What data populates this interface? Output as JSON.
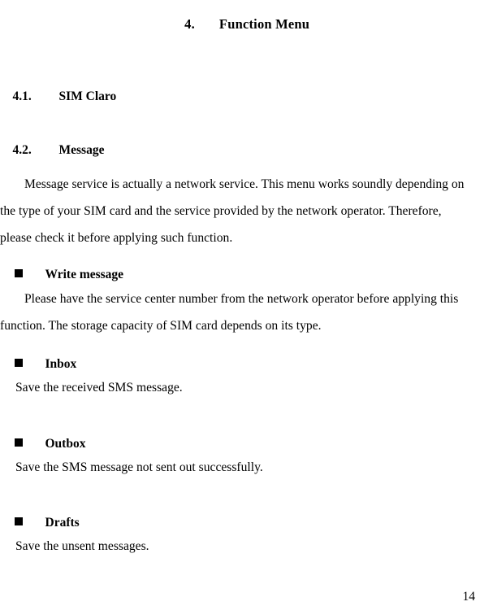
{
  "document": {
    "title_number": "4.",
    "title_text": "Function Menu",
    "page_number": "14"
  },
  "sections": [
    {
      "number": "4.1.",
      "title": "SIM Claro"
    },
    {
      "number": "4.2.",
      "title": "Message"
    }
  ],
  "paragraphs": {
    "intro": "Message service is actually a network service. This menu works soundly depending on the type of your SIM card and the service provided by the network operator. Therefore, please check it before applying such function.",
    "write_message_body": "Please have the service center number from the network operator before applying this function. The storage capacity of SIM card depends on its type."
  },
  "bullets": [
    {
      "label": "Write message",
      "description": ""
    },
    {
      "label": "Inbox",
      "description": "Save the received SMS message."
    },
    {
      "label": "Outbox",
      "description": "Save the SMS message not sent out successfully."
    },
    {
      "label": "Drafts",
      "description": "Save the unsent messages."
    }
  ],
  "colors": {
    "text": "#000000",
    "background": "#ffffff",
    "bullet": "#000000"
  }
}
